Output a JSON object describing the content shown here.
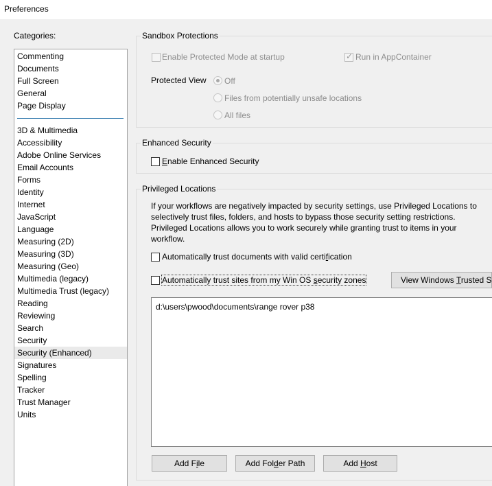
{
  "window": {
    "title": "Preferences"
  },
  "categories": {
    "label": "Categories:",
    "top_items": [
      "Commenting",
      "Documents",
      "Full Screen",
      "General",
      "Page Display"
    ],
    "items": [
      "3D & Multimedia",
      "Accessibility",
      "Adobe Online Services",
      "Email Accounts",
      "Forms",
      "Identity",
      "Internet",
      "JavaScript",
      "Language",
      "Measuring (2D)",
      "Measuring (3D)",
      "Measuring (Geo)",
      "Multimedia (legacy)",
      "Multimedia Trust (legacy)",
      "Reading",
      "Reviewing",
      "Search",
      "Security",
      "Security (Enhanced)",
      "Signatures",
      "Spelling",
      "Tracker",
      "Trust Manager",
      "Units"
    ],
    "selected": "Security (Enhanced)"
  },
  "sandbox": {
    "title": "Sandbox Protections",
    "protected_mode_label": "Enable Protected Mode at startup",
    "protected_mode_checked": false,
    "app_container_label": "Run in AppContainer",
    "app_container_checked": true,
    "protected_view_label": "Protected View",
    "options": [
      "Off",
      "Files from potentially unsafe locations",
      "All files"
    ],
    "selected_option": "Off"
  },
  "enhanced": {
    "title": "Enhanced Security",
    "enable_label_pre": "",
    "enable_label_key": "E",
    "enable_label_post": "nable Enhanced Security",
    "enable_checked": false
  },
  "privileged": {
    "title": "Privileged Locations",
    "description": "If your workflows are negatively impacted by security settings, use Privileged Locations to selectively trust files, folders, and hosts to bypass those security setting restrictions. Privileged Locations allows you to work securely while granting trust to items in your workflow.",
    "trust_cert_pre": "Automatically trust documents with valid certi",
    "trust_cert_key": "f",
    "trust_cert_post": "ication",
    "trust_cert_checked": false,
    "trust_sites_pre": "Automatically trust sites from my Win OS ",
    "trust_sites_key": "s",
    "trust_sites_post": "ecurity zones",
    "trust_sites_checked": false,
    "view_trusted_pre": "View Windows ",
    "view_trusted_key": "T",
    "view_trusted_post": "rusted Sit",
    "locations": [
      "d:\\users\\pwood\\documents\\range rover p38"
    ],
    "add_file_pre": "Add F",
    "add_file_key": "i",
    "add_file_post": "le",
    "add_folder_pre": "Add Fol",
    "add_folder_key": "d",
    "add_folder_post": "er Path",
    "add_host_pre": "Add ",
    "add_host_key": "H",
    "add_host_post": "ost"
  }
}
